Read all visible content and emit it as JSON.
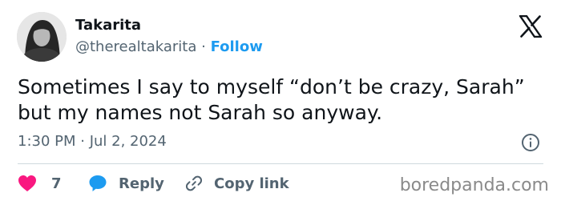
{
  "author": {
    "display_name": "Takarita",
    "handle": "@therealtakarita",
    "separator": "·",
    "follow_label": "Follow"
  },
  "tweet": {
    "lines": [
      "Sometimes I say to myself “don’t be crazy, Sarah”",
      "but my names not Sarah so anyway."
    ],
    "timestamp": "1:30 PM · Jul 2, 2024"
  },
  "actions": {
    "like_count": "7",
    "reply_label": "Reply",
    "copy_link_label": "Copy link"
  },
  "icons": {
    "logo": "x-logo-icon",
    "info": "info-icon",
    "like": "heart-icon",
    "reply": "speech-bubble-icon",
    "copy": "link-icon"
  },
  "colors": {
    "follow": "#1d9bf0",
    "like": "#f91880",
    "reply": "#1d9bf0",
    "secondary_text": "#536471"
  },
  "watermark": "boredpanda.com"
}
